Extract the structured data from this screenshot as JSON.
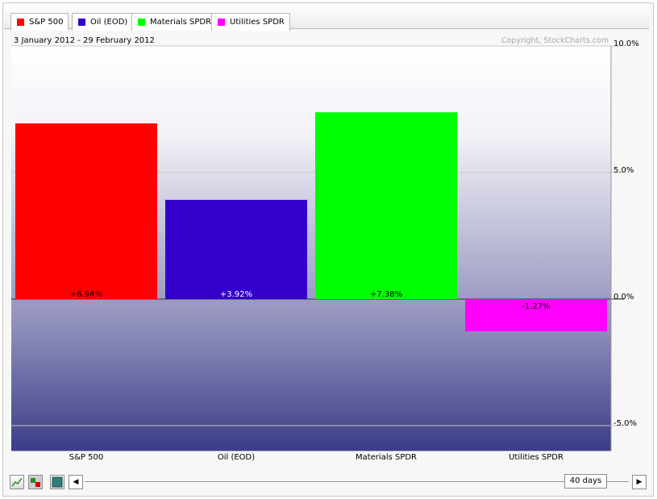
{
  "date_range": "3 January 2012 - 29 February 2012",
  "copyright": "Copyright, StockCharts.com",
  "legend": [
    {
      "label": "S&P 500",
      "color": "#ff0000"
    },
    {
      "label": "Oil (EOD)",
      "color": "#3300cc"
    },
    {
      "label": "Materials SPDR",
      "color": "#00ff00"
    },
    {
      "label": "Utilities SPDR",
      "color": "#ff00ff"
    }
  ],
  "controls": {
    "period_label": "40 days",
    "prev_icon": "left-arrow-icon",
    "next_icon": "right-arrow-icon",
    "line_mode_icon": "line-chart-icon",
    "bar_mode_icon": "bar-chart-icon",
    "square_icon": "square-icon"
  },
  "chart_data": {
    "type": "bar",
    "categories": [
      "S&P 500",
      "Oil (EOD)",
      "Materials SPDR",
      "Utilities SPDR"
    ],
    "values": [
      6.94,
      3.92,
      7.38,
      -1.27
    ],
    "data_labels": [
      "+6.94%",
      "+3.92%",
      "+7.38%",
      "-1.27%"
    ],
    "colors": [
      "#ff0000",
      "#3300cc",
      "#00ff00",
      "#ff00ff"
    ],
    "yticks": [
      "10.0%",
      "5.0%",
      "0.0%",
      "-5.0%"
    ],
    "ytick_values": [
      10,
      5,
      0,
      -5
    ],
    "ylim": [
      -6,
      10
    ],
    "grid": true,
    "y_axis_side": "right"
  }
}
